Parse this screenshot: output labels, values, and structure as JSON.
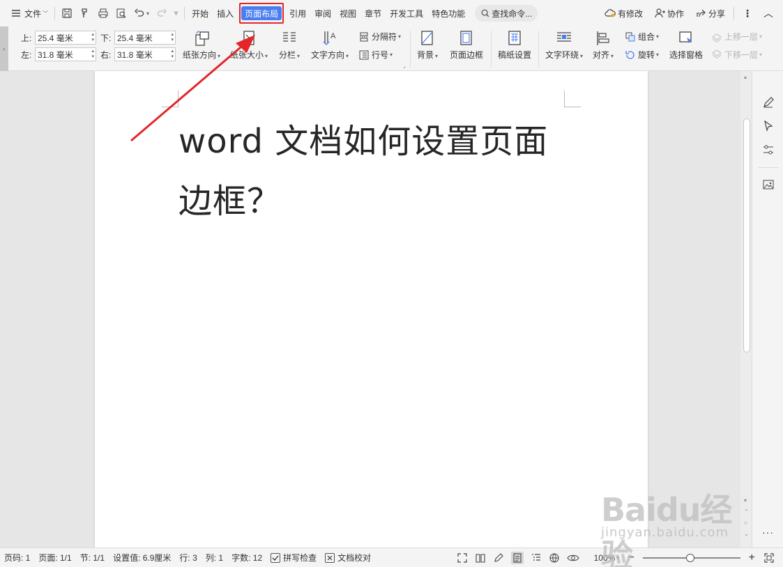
{
  "menubar": {
    "file_label": "文件",
    "tabs": [
      "开始",
      "插入",
      "页面布局",
      "引用",
      "审阅",
      "视图",
      "章节",
      "开发工具",
      "特色功能"
    ],
    "active_tab": "页面布局",
    "search_placeholder": "查找命令...",
    "modified_label": "有修改",
    "collab_label": "协作",
    "share_label": "分享"
  },
  "ribbon": {
    "margins": {
      "top_label": "上:",
      "top_value": "25.4 毫米",
      "bottom_label": "下:",
      "bottom_value": "25.4 毫米",
      "left_label": "左:",
      "left_value": "31.8 毫米",
      "right_label": "右:",
      "right_value": "31.8 毫米"
    },
    "orientation": "纸张方向",
    "size": "纸张大小",
    "columns": "分栏",
    "text_direction": "文字方向",
    "breaks": "分隔符",
    "line_numbers": "行号",
    "background": "背景",
    "page_border": "页面边框",
    "manuscript": "稿纸设置",
    "text_wrap": "文字环绕",
    "align": "对齐",
    "group": "组合",
    "rotate": "旋转",
    "selection_pane": "选择窗格",
    "bring_forward": "上移一层",
    "send_backward": "下移一层"
  },
  "document": {
    "title_line1": "word 文档如何设置页面",
    "title_line2": "边框？"
  },
  "status": {
    "page_num": "页码: 1",
    "pages": "页面: 1/1",
    "section": "节: 1/1",
    "setting": "设置值: 6.9厘米",
    "row": "行: 3",
    "col": "列: 1",
    "words": "字数: 12",
    "spell_check": "拼写检查",
    "doc_proof": "文档校对",
    "zoom": "100%"
  },
  "watermark": {
    "brand": "Baidu经验",
    "url": "jingyan.baidu.com"
  },
  "colors": {
    "accent": "#4a7ef0",
    "highlight_red": "#e3262a",
    "ribbon_bg": "#f4f4f4",
    "canvas_bg": "#e6e6e6"
  }
}
